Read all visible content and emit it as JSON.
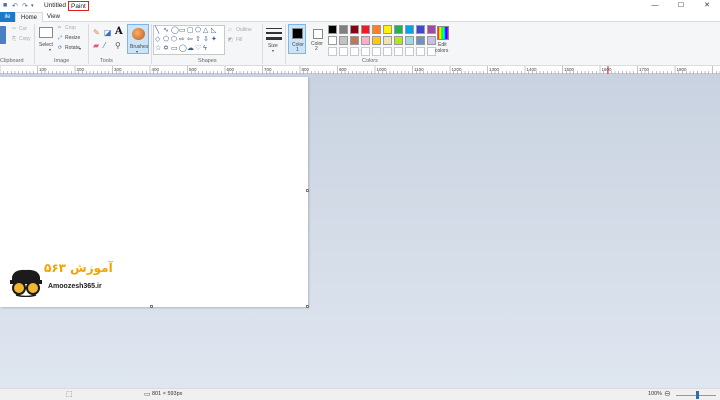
{
  "titlebar": {
    "document": "Untitled",
    "app": "Paint",
    "minimize": "—",
    "maximize": "☐",
    "close": "✕"
  },
  "tabs": {
    "file": "ile",
    "home": "Home",
    "view": "View"
  },
  "clipboard": {
    "cut": "Cut",
    "copy": "Copy",
    "group": "Clipboard"
  },
  "image": {
    "select": "Select",
    "crop": "Crop",
    "resize": "Resize",
    "rotate": "Rotate",
    "group": "Image"
  },
  "tools": {
    "group": "Tools",
    "text_glyph": "A"
  },
  "brushes": {
    "label": "Brushes"
  },
  "shapes": {
    "outline": "Outline",
    "fill": "Fill",
    "group": "Shapes"
  },
  "size": {
    "label": "Size"
  },
  "colors": {
    "color1_label": "Color",
    "color1_num": "1",
    "color2_label": "Color",
    "color2_num": "2",
    "edit_label": "Edit",
    "edit_label2": "colors",
    "group": "Colors",
    "color1_value": "#000000",
    "color2_value": "#ffffff",
    "palette_row1": [
      "#000000",
      "#7f7f7f",
      "#880015",
      "#ed1c24",
      "#ff7f27",
      "#fff200",
      "#22b14c",
      "#00a2e8",
      "#3f48cc",
      "#a349a4"
    ],
    "palette_row2": [
      "#ffffff",
      "#c3c3c3",
      "#b97a57",
      "#ffaec9",
      "#ffc90e",
      "#efe4b0",
      "#b5e61d",
      "#99d9ea",
      "#7092be",
      "#c8bfe7"
    ]
  },
  "ruler": {
    "ticks": [
      "100",
      "200",
      "300",
      "400",
      "500",
      "600",
      "700",
      "800",
      "900",
      "1000",
      "1100",
      "1200",
      "1300",
      "1400",
      "1500",
      "1600",
      "1700",
      "1800"
    ]
  },
  "watermark": {
    "persian": "آموزش ۳۶۵",
    "latin": "Amoozesh365.ir"
  },
  "status": {
    "canvas_size": "801 × 593px",
    "zoom": "100%"
  }
}
